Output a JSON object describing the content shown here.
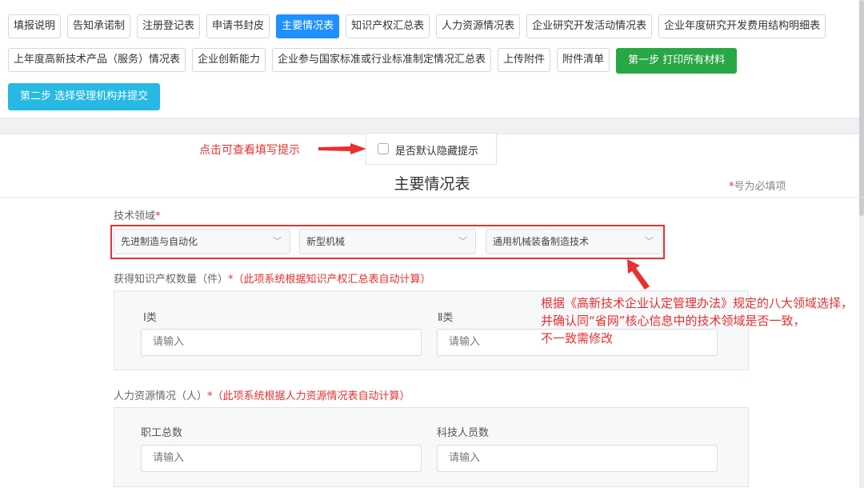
{
  "tabs": {
    "row1": [
      "填报说明",
      "告知承诺制",
      "注册登记表",
      "申请书封皮",
      "主要情况表",
      "知识产权汇总表",
      "人力资源情况表",
      "企业研究开发活动情况表",
      "企业年度研究开发费用结构明细表"
    ],
    "row2": [
      "上年度高新技术产品（服务）情况表",
      "企业创新能力",
      "企业参与国家标准或行业标准制定情况汇总表",
      "上传附件",
      "附件清单"
    ],
    "step1": "第一步 打印所有材料",
    "step2": "第二步 选择受理机构并提交",
    "active": "主要情况表"
  },
  "hint": {
    "text": "点击可查看填写提示",
    "checkbox_label": "是否默认隐藏提示"
  },
  "form": {
    "title": "主要情况表",
    "required_star": "*",
    "required_note": "号为必填项",
    "tech_field": {
      "label": "技术领域",
      "req": "*",
      "select1": "先进制造与自动化",
      "select2": "新型机械",
      "select3": "通用机械装备制造技术"
    },
    "ip": {
      "label": "获得知识产权数量（件）",
      "req": "*（此项系统根据知识产权汇总表自动计算）",
      "class1": "Ⅰ类",
      "class2": "Ⅱ类",
      "placeholder": "请输入"
    },
    "hr": {
      "label": "人力资源情况（人）",
      "req": "*（此项系统根据人力资源情况表自动计算）",
      "total": "职工总数",
      "tech": "科技人员数",
      "placeholder": "请输入"
    }
  },
  "annotation": {
    "line1": "根据《高新技术企业认定管理办法》规定的八大领域选择，",
    "line2": "并确认同“省网”核心信息中的技术领域是否一致，",
    "line3": "不一致需修改"
  },
  "colors": {
    "active_tab": "#1e90ff",
    "step1": "#28a745",
    "step2": "#27b9e4",
    "annotation": "#e8302f"
  }
}
